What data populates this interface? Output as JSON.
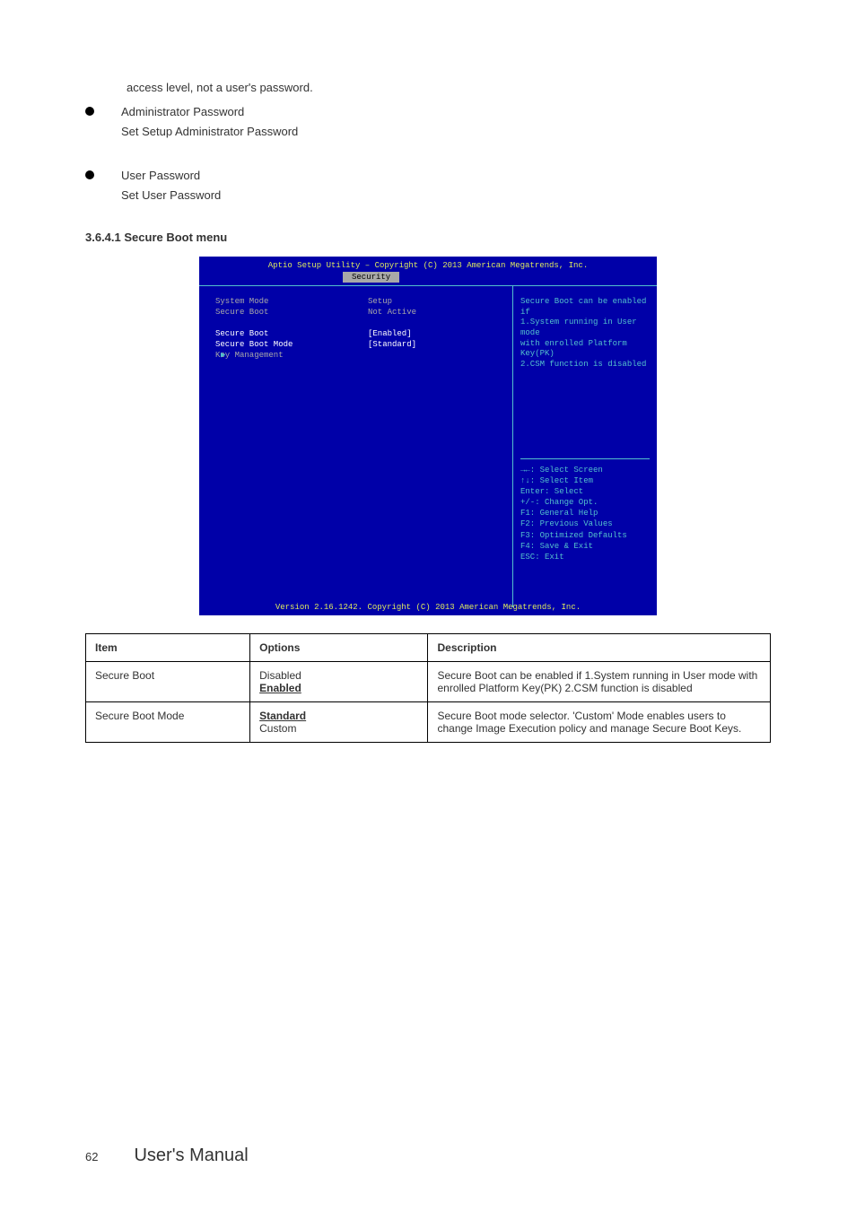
{
  "topNote": "access level, not a user's password.",
  "bullets": [
    {
      "title": "Administrator Password",
      "body": "Set Setup Administrator Password"
    },
    {
      "title": "User Password",
      "body": "Set User Password"
    }
  ],
  "sectionHeading": "3.6.4.1 Secure Boot menu",
  "bios": {
    "titleBar": "Aptio Setup Utility – Copyright (C) 2013 American Megatrends, Inc.",
    "tab": "Security",
    "leftRows": [
      {
        "label": "System Mode",
        "value": "Setup",
        "style": "gray"
      },
      {
        "label": "Secure Boot",
        "value": "Not Active",
        "style": "gray"
      },
      {
        "label": "",
        "value": "",
        "style": "gray"
      },
      {
        "label": "Secure Boot",
        "value": "[Enabled]",
        "style": "white"
      },
      {
        "label": "Secure Boot Mode",
        "value": "[Standard]",
        "style": "white"
      }
    ],
    "submenu": {
      "arrow": "▶",
      "label": "Key Management"
    },
    "helpTop": [
      "Secure Boot can be enabled if",
      "1.System running in User mode",
      "with enrolled Platform Key(PK)",
      "2.CSM function is disabled"
    ],
    "keys": [
      "→←: Select Screen",
      "↑↓: Select Item",
      "Enter: Select",
      "+/-: Change Opt.",
      "F1: General Help",
      "F2: Previous Values",
      "F3: Optimized Defaults",
      "F4: Save & Exit",
      "ESC: Exit"
    ],
    "footer": "Version 2.16.1242. Copyright (C) 2013 American Megatrends, Inc."
  },
  "table": {
    "headers": [
      "Item",
      "Options",
      "Description"
    ],
    "rows": [
      {
        "item": "Secure Boot",
        "options": [
          {
            "text": "Disabled",
            "default": false
          },
          {
            "text": "Enabled",
            "default": true
          }
        ],
        "desc": "Secure Boot can be enabled if 1.System running in User mode with enrolled Platform Key(PK) 2.CSM function is disabled"
      },
      {
        "item": "Secure Boot Mode",
        "options": [
          {
            "text": "Standard",
            "default": true
          },
          {
            "text": "Custom",
            "default": false
          }
        ],
        "desc": "Secure Boot mode selector. 'Custom' Mode enables users to change Image Execution policy and manage Secure Boot Keys."
      }
    ]
  },
  "footer": {
    "page": "62",
    "title": "User's Manual"
  }
}
